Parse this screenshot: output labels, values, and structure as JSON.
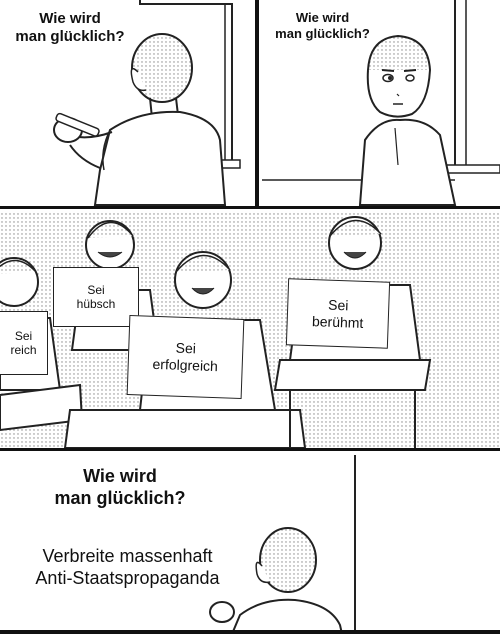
{
  "panels": {
    "top_left": {
      "question": "Wie wird\nman glücklich?"
    },
    "top_right": {
      "question": "Wie wird\nman glücklich?"
    },
    "middle": {
      "signs": {
        "left": "Sei\nreich",
        "left_center": "Sei\nhübsch",
        "center": "Sei\nerfolgreich",
        "right": "Sei\nberühmt"
      }
    },
    "bottom": {
      "question": "Wie wird\nman glücklich?",
      "answer": "Verbreite massenhaft\nAnti-Staatspropaganda"
    }
  }
}
